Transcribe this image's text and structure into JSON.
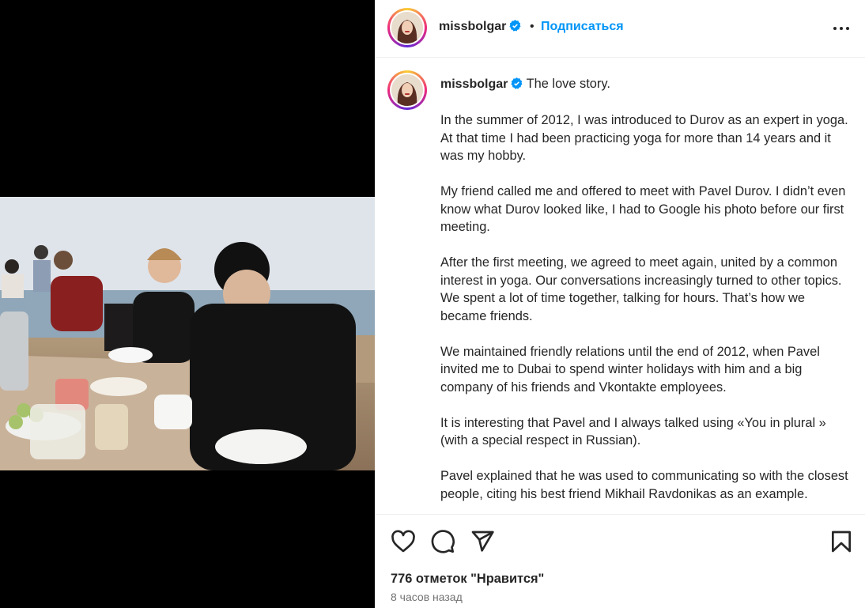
{
  "post": {
    "username": "missbolgar",
    "follow_label": "Подписаться",
    "dot": "•",
    "caption_first": "The love story.",
    "paragraphs": [
      "In the summer of 2012, I was introduced to Durov as an expert in yoga. At that time I had been practicing yoga for more than 14 years and it was my hobby.",
      "My friend called me and offered to meet with Pavel Durov. I didn’t even know what Durov looked like, I had to Google his photo before our first meeting.",
      "After the first meeting, we agreed to meet again, united by a common interest in yoga. Our conversations increasingly turned to other topics. We spent a lot of time together, talking for hours. That’s how we became friends.",
      "We maintained friendly relations until the end of 2012, when Pavel invited me to Dubai to spend winter holidays with him and a big company of his friends and Vkontakte employees.",
      "It is interesting that Pavel and I always talked using «You in plural » (with a special respect in Russian).",
      "Pavel explained that he was used to communicating so with the closest people, citing his best friend Mikhail Ravdonikas as an example."
    ],
    "likes": "776 отметок \"Нравится\"",
    "time": "8 часов назад"
  },
  "icons": {
    "verified": "verified-badge-icon",
    "more": "more-options-icon",
    "like": "heart-icon",
    "comment": "comment-icon",
    "share": "send-icon",
    "save": "bookmark-icon"
  },
  "colors": {
    "accent": "#0095f6",
    "text": "#262626",
    "muted": "#737373"
  }
}
